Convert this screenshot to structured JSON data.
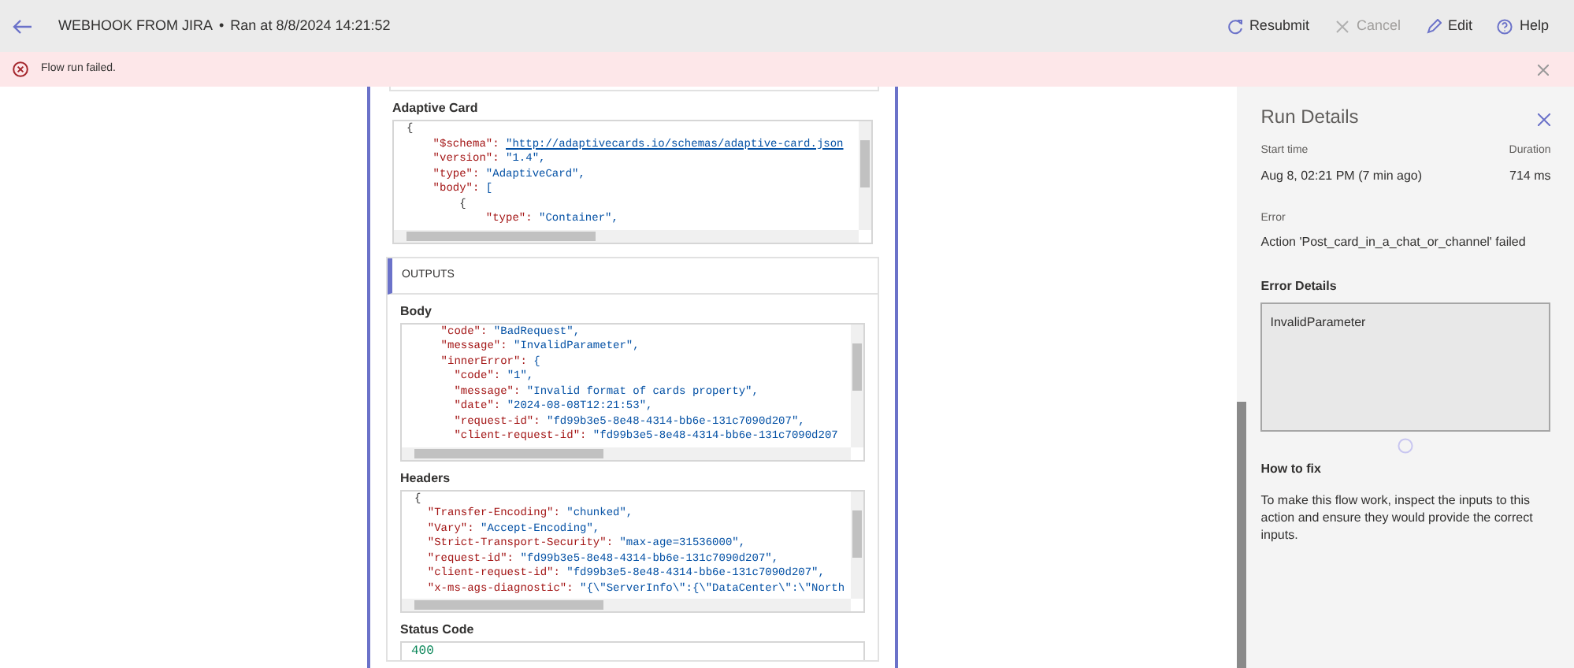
{
  "header": {
    "title": "WEBHOOK FROM JIRA",
    "separator": "•",
    "subtitle": "Ran at 8/8/2024 14:21:52",
    "actions": [
      {
        "label": "Resubmit",
        "disabled": false
      },
      {
        "label": "Cancel",
        "disabled": true
      },
      {
        "label": "Edit",
        "disabled": false
      },
      {
        "label": "Help",
        "disabled": false
      }
    ]
  },
  "error_banner": {
    "message": "Flow run failed."
  },
  "action_card": {
    "inputs": [
      {
        "label": "Adaptive Card",
        "kind": "code",
        "lines": [
          {
            "text": "{",
            "link": false
          },
          {
            "text": "    \"$schema\": \"http://adaptivecards.io/schemas/adaptive-card.json",
            "link": true
          },
          {
            "text": "    \"version\": \"1.4\",",
            "link": false
          },
          {
            "text": "    \"type\": \"AdaptiveCard\",",
            "link": false
          },
          {
            "text": "    \"body\": [",
            "link": false
          },
          {
            "text": "        {",
            "link": false
          },
          {
            "text": "            \"type\": \"Container\",",
            "link": false
          }
        ]
      }
    ],
    "outputs": {
      "title": "OUTPUTS",
      "fields": [
        {
          "label": "Body",
          "kind": "code",
          "lines": [
            {
              "text": "    \"code\": \"BadRequest\",",
              "link": false
            },
            {
              "text": "    \"message\": \"InvalidParameter\",",
              "link": false
            },
            {
              "text": "    \"innerError\": {",
              "link": false
            },
            {
              "text": "      \"code\": \"1\",",
              "link": false
            },
            {
              "text": "      \"message\": \"Invalid format of cards property\",",
              "link": false
            },
            {
              "text": "      \"date\": \"2024-08-08T12:21:53\",",
              "link": false
            },
            {
              "text": "      \"request-id\": \"fd99b3e5-8e48-4314-bb6e-131c7090d207\",",
              "link": false
            },
            {
              "text": "      \"client-request-id\": \"fd99b3e5-8e48-4314-bb6e-131c7090d207",
              "link": false
            }
          ]
        },
        {
          "label": "Headers",
          "kind": "code",
          "lines": [
            {
              "text": "{",
              "link": false
            },
            {
              "text": "  \"Transfer-Encoding\": \"chunked\",",
              "link": false
            },
            {
              "text": "  \"Vary\": \"Accept-Encoding\",",
              "link": false
            },
            {
              "text": "  \"Strict-Transport-Security\": \"max-age=31536000\",",
              "link": false
            },
            {
              "text": "  \"request-id\": \"fd99b3e5-8e48-4314-bb6e-131c7090d207\",",
              "link": false
            },
            {
              "text": "  \"client-request-id\": \"fd99b3e5-8e48-4314-bb6e-131c7090d207\",",
              "link": false
            },
            {
              "text": "  \"x-ms-ags-diagnostic\": \"{\\\"ServerInfo\\\":{\\\"DataCenter\\\":\\\"North",
              "link": false
            }
          ]
        },
        {
          "label": "Status Code",
          "kind": "value",
          "value": "400"
        }
      ]
    }
  },
  "run_details": {
    "title": "Run Details",
    "start_label": "Start time",
    "start_value": "Aug 8, 02:21 PM (7 min ago)",
    "duration_label": "Duration",
    "duration_value": "714 ms",
    "error_label": "Error",
    "error_value": "Action 'Post_card_in_a_chat_or_channel' failed",
    "details_label": "Error Details",
    "details_value": "InvalidParameter",
    "fix_title": "How to fix",
    "fix_text": "To make this flow work, inspect the inputs to this action and ensure they would provide the correct inputs."
  }
}
